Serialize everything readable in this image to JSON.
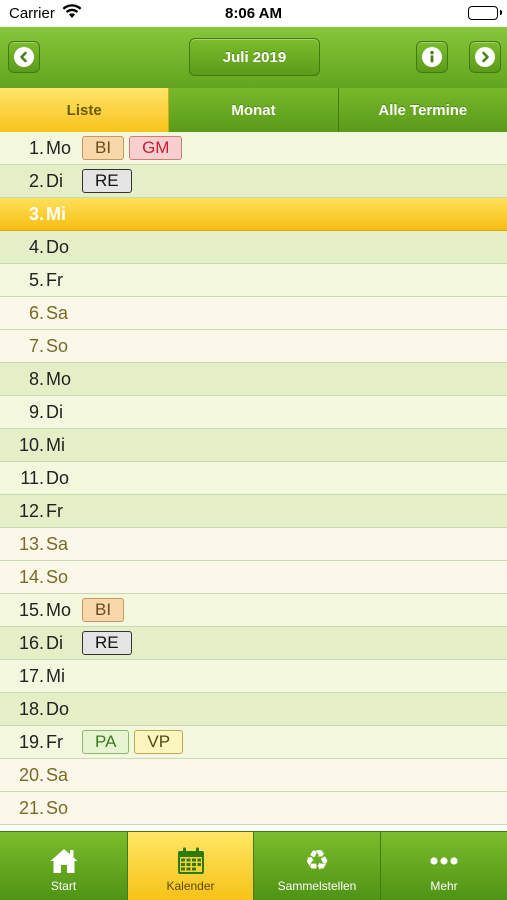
{
  "status_bar": {
    "carrier": "Carrier",
    "time": "8:06 AM"
  },
  "header": {
    "month_label": "Juli 2019",
    "prev_icon": "chevron-left-icon",
    "info_icon": "info-icon",
    "next_icon": "chevron-right-icon"
  },
  "tabs": [
    {
      "label": "Liste",
      "active": true
    },
    {
      "label": "Monat",
      "active": false
    },
    {
      "label": "Alle Termine",
      "active": false
    }
  ],
  "days": [
    {
      "num": "1.",
      "name": "Mo",
      "tags": [
        "BI",
        "GM"
      ]
    },
    {
      "num": "2.",
      "name": "Di",
      "tags": [
        "RE"
      ]
    },
    {
      "num": "3.",
      "name": "Mi",
      "tags": [],
      "today": true
    },
    {
      "num": "4.",
      "name": "Do",
      "tags": []
    },
    {
      "num": "5.",
      "name": "Fr",
      "tags": []
    },
    {
      "num": "6.",
      "name": "Sa",
      "tags": [],
      "weekend": true
    },
    {
      "num": "7.",
      "name": "So",
      "tags": [],
      "weekend": true
    },
    {
      "num": "8.",
      "name": "Mo",
      "tags": []
    },
    {
      "num": "9.",
      "name": "Di",
      "tags": []
    },
    {
      "num": "10.",
      "name": "Mi",
      "tags": []
    },
    {
      "num": "11.",
      "name": "Do",
      "tags": []
    },
    {
      "num": "12.",
      "name": "Fr",
      "tags": []
    },
    {
      "num": "13.",
      "name": "Sa",
      "tags": [],
      "weekend": true
    },
    {
      "num": "14.",
      "name": "So",
      "tags": [],
      "weekend": true
    },
    {
      "num": "15.",
      "name": "Mo",
      "tags": [
        "BI"
      ]
    },
    {
      "num": "16.",
      "name": "Di",
      "tags": [
        "RE"
      ]
    },
    {
      "num": "17.",
      "name": "Mi",
      "tags": []
    },
    {
      "num": "18.",
      "name": "Do",
      "tags": []
    },
    {
      "num": "19.",
      "name": "Fr",
      "tags": [
        "PA",
        "VP"
      ]
    },
    {
      "num": "20.",
      "name": "Sa",
      "tags": [],
      "weekend": true
    },
    {
      "num": "21.",
      "name": "So",
      "tags": [],
      "weekend": true
    }
  ],
  "tabbar": [
    {
      "label": "Start",
      "icon": "home-icon",
      "active": false
    },
    {
      "label": "Kalender",
      "icon": "calendar-icon",
      "active": true
    },
    {
      "label": "Sammelstellen",
      "icon": "recycle-icon",
      "active": false
    },
    {
      "label": "Mehr",
      "icon": "more-icon",
      "active": false
    }
  ],
  "colors": {
    "header_green": "#6fb326",
    "active_yellow": "#f8c21a",
    "weekday_row": "#f3f7de",
    "weekend_row": "#fbf8ea"
  }
}
